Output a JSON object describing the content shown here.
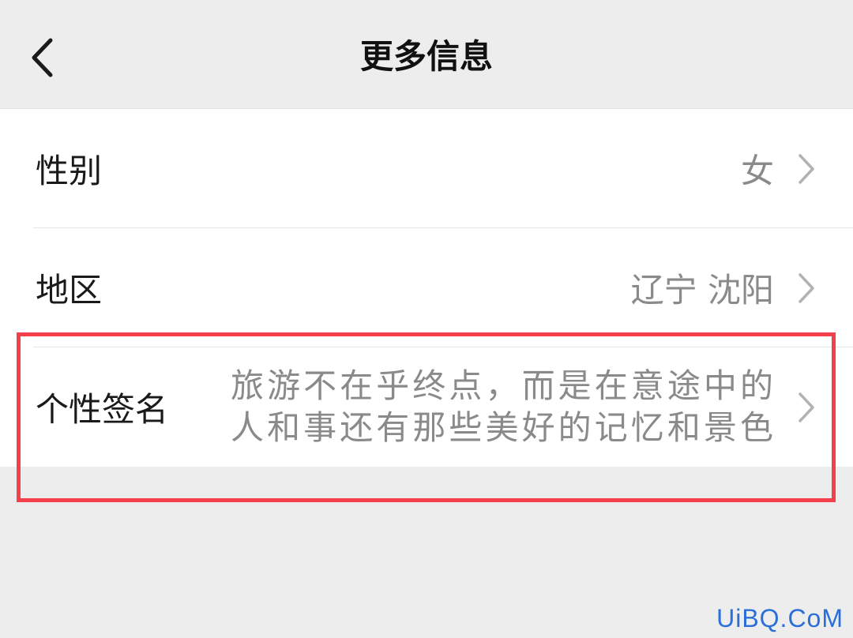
{
  "nav": {
    "title": "更多信息",
    "back_icon": "chevron-left-icon"
  },
  "rows": [
    {
      "label": "性别",
      "value": "女"
    },
    {
      "label": "地区",
      "value": "辽宁 沈阳"
    },
    {
      "label": "个性签名",
      "value_line1": "旅游不在乎终点，而是在意途中的",
      "value_line2": "人和事还有那些美好的记忆和景色"
    }
  ],
  "highlight_color": "#f3404b",
  "watermark": "UiBQ.CoM",
  "colors": {
    "background": "#ededed",
    "card": "#ffffff",
    "primary_text": "#1a1a1a",
    "secondary_text": "#8a8a8a",
    "chevron": "#b2b2b2"
  }
}
